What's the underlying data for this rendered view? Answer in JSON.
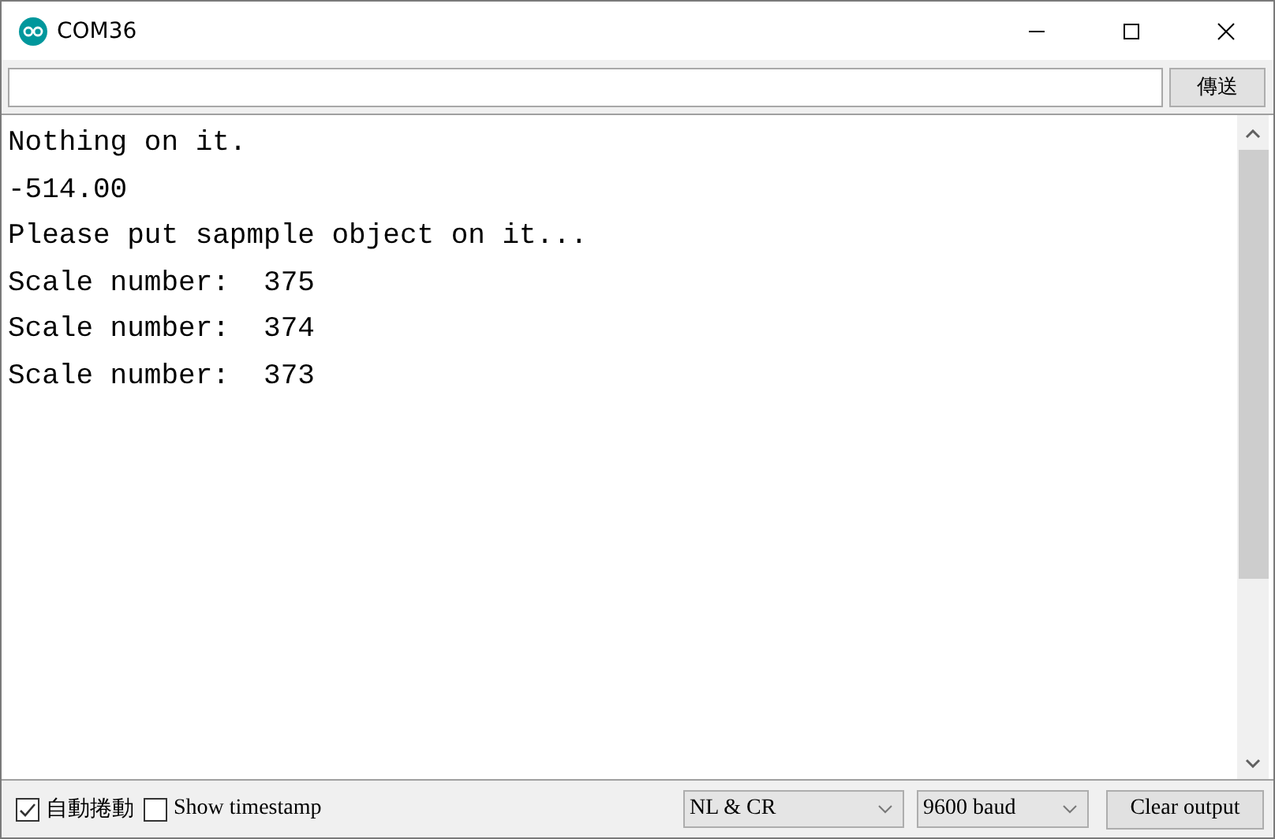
{
  "window": {
    "title": "COM36"
  },
  "send_button": "傳送",
  "output_lines": [
    "Nothing on it.",
    "-514.00",
    "Please put sapmple object on it...",
    "Scale number:  375",
    "Scale number:  374",
    "Scale number:  373"
  ],
  "autoscroll": {
    "label": "自動捲動",
    "checked": true
  },
  "timestamp": {
    "label": "Show timestamp",
    "checked": false
  },
  "line_ending": "NL & CR",
  "baud_rate": "9600 baud",
  "clear_button": "Clear output"
}
